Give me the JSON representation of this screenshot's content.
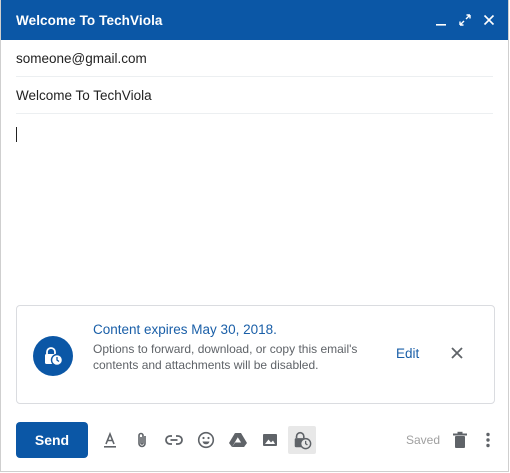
{
  "window": {
    "title": "Welcome To TechViola",
    "controls": [
      "minimize-icon",
      "expand-icon",
      "close-icon"
    ]
  },
  "compose": {
    "to": "someone@gmail.com",
    "subject": "Welcome To TechViola",
    "body": ""
  },
  "confidential_notice": {
    "icon": "lock-clock-icon",
    "title": "Content expires May 30, 2018.",
    "description": "Options to forward, download, or copy this email's contents and attachments will be disabled.",
    "edit_label": "Edit"
  },
  "toolbar": {
    "send_label": "Send",
    "tools": [
      "format-text-icon",
      "attach-icon",
      "link-icon",
      "emoji-icon",
      "drive-icon",
      "photo-icon",
      "confidential-mode-icon"
    ],
    "saved_label": "Saved",
    "trailing": [
      "trash-icon",
      "more-options-icon"
    ]
  },
  "colors": {
    "accent": "#0b57a6",
    "link": "#1a5fa8",
    "muted": "#5f6368"
  }
}
